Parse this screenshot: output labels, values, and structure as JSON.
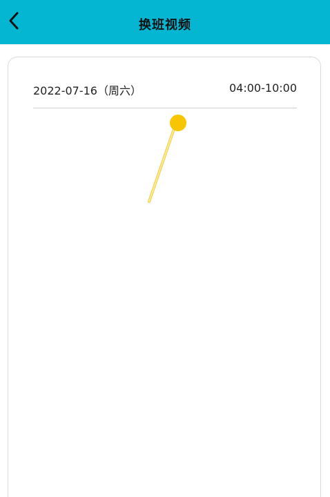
{
  "header": {
    "title": "换班视频",
    "background_color": "#04b6d2",
    "back_icon": "chevron-left-icon"
  },
  "shift": {
    "date": "2022-07-16（周六）",
    "time_range": "04:00-10:00"
  },
  "overlay": {
    "pointer_color": "#f7c600",
    "pointer_icon": "annotation-pointer-icon"
  }
}
